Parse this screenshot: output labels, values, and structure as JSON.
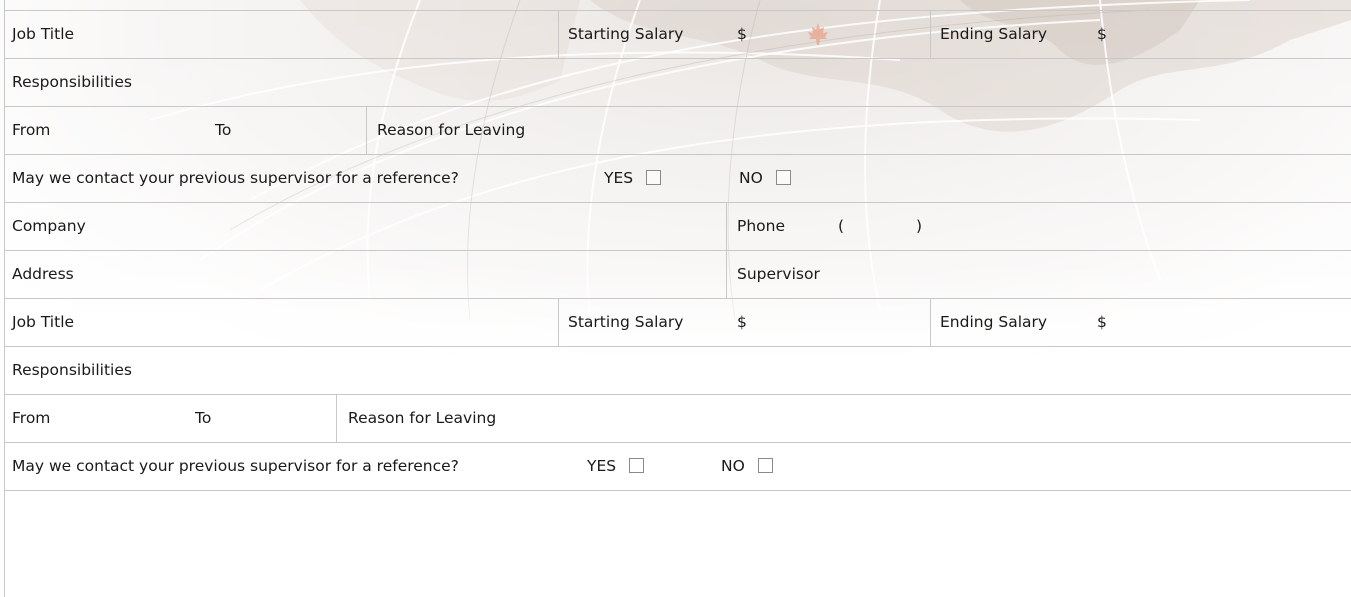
{
  "entries": [
    {
      "job_title_label": "Job Title",
      "starting_salary_label": "Starting Salary",
      "starting_salary_currency": "$",
      "ending_salary_label": "Ending Salary",
      "ending_salary_currency": "$",
      "responsibilities_label": "Responsibilities",
      "from_label": "From",
      "to_label": "To",
      "reason_label": "Reason for Leaving",
      "contact_question": "May we contact your previous supervisor for a reference?",
      "yes_label": "YES",
      "no_label": "NO"
    },
    {
      "company_label": "Company",
      "phone_label": "Phone",
      "phone_open": "(",
      "phone_close": ")",
      "address_label": "Address",
      "supervisor_label": "Supervisor",
      "job_title_label": "Job Title",
      "starting_salary_label": "Starting Salary",
      "starting_salary_currency": "$",
      "ending_salary_label": "Ending Salary",
      "ending_salary_currency": "$",
      "responsibilities_label": "Responsibilities",
      "from_label": "From",
      "to_label": "To",
      "reason_label": "Reason for Leaving",
      "contact_question": "May we contact your previous supervisor for a reference?",
      "yes_label": "YES",
      "no_label": "NO"
    }
  ],
  "colors": {
    "border": "#c8c8c8",
    "text": "#1a1a1a",
    "maple_leaf": "#e8a08a"
  }
}
